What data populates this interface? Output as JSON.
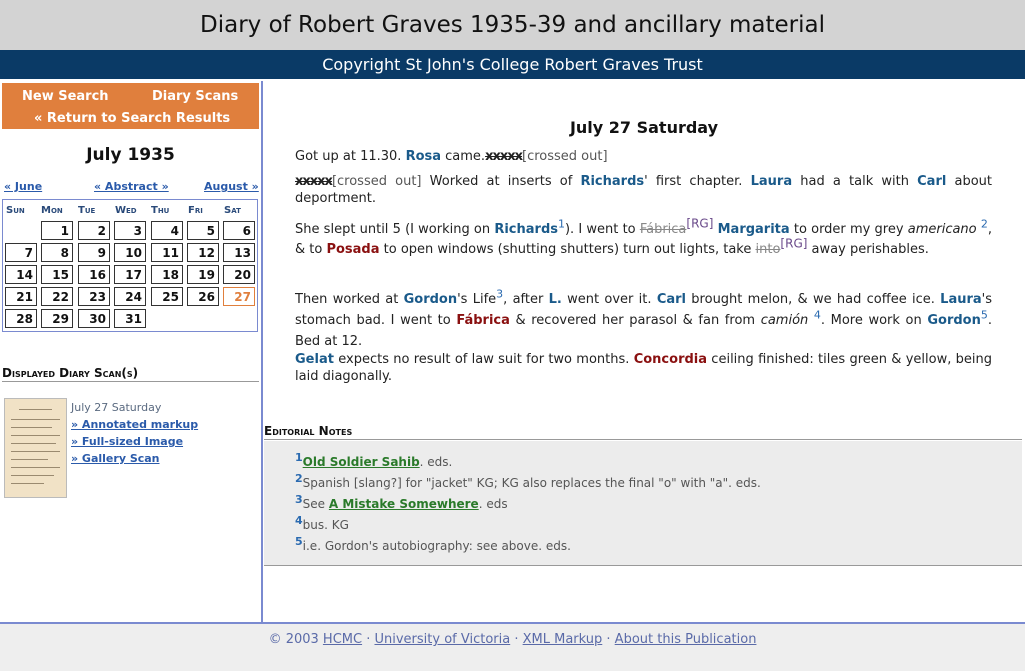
{
  "header": {
    "title": "Diary of Robert Graves 1935-39 and ancillary material",
    "copyright": "Copyright St John's College Robert Graves Trust"
  },
  "nav": {
    "new_search": "New Search",
    "diary_scans": "Diary Scans",
    "return": "« Return to Search Results"
  },
  "calendar": {
    "title": "July 1935",
    "prev": "« June",
    "abstract": "« Abstract »",
    "next": "August »",
    "dow": [
      "Sun",
      "Mon",
      "Tue",
      "Wed",
      "Thu",
      "Fri",
      "Sat"
    ],
    "days": [
      "1",
      "2",
      "3",
      "4",
      "5",
      "6",
      "7",
      "8",
      "9",
      "10",
      "11",
      "12",
      "13",
      "14",
      "15",
      "16",
      "17",
      "18",
      "19",
      "20",
      "21",
      "22",
      "23",
      "24",
      "25",
      "26",
      "27",
      "28",
      "29",
      "30",
      "31"
    ],
    "current_day": "27"
  },
  "scans": {
    "heading": "Displayed Diary Scan(s)",
    "date": "July 27 Saturday",
    "annotated": "» Annotated markup",
    "full": "» Full-sized Image",
    "gallery": "» Gallery Scan"
  },
  "entry": {
    "date": "July 27 Saturday",
    "p1": {
      "a": "Got up at 11.30. ",
      "rosa": "Rosa",
      "b": " came.",
      "x": "xxxxx",
      "c": "[crossed out]"
    },
    "p2": {
      "x": "xxxxx",
      "c": "[crossed out]",
      "a": " Worked at inserts of ",
      "richards": "Richards",
      "b": "' first chapter. ",
      "laura": "Laura",
      "c2": " had a talk with ",
      "carl": "Carl",
      "d": " about deportment."
    },
    "p3": {
      "a": "She slept until 5 (I working on ",
      "richards": "Richards",
      "fn1": "1",
      "b": "). I went to ",
      "fabrica": "Fábrica",
      "rg1": "[RG]",
      "c": " ",
      "margarita": "Margarita",
      "d": " to order my grey ",
      "americano": "americano",
      "fn2": "2",
      "e": ", & to ",
      "posada": "Posada",
      "f": " to open windows (shutting shutters) turn out lights, take ",
      "into": "into",
      "rg2": "[RG]",
      "g": " away perishables."
    },
    "p4": {
      "a": "Then worked at ",
      "gordon": "Gordon",
      "b": "'s Life",
      "fn3": "3",
      "c": ", after ",
      "l": "L.",
      "d": " went over it. ",
      "carl": "Carl",
      "e": " brought melon, & we had coffee ice. ",
      "laura": "Laura",
      "f": "'s stomach bad. I went to ",
      "fabrica": "Fábrica",
      "g": " & recovered her parasol & fan from ",
      "camion": "camión",
      "fn4": "4",
      "h": ". More work on ",
      "gordon2": "Gordon",
      "fn5": "5",
      "i": ". Bed at 12."
    },
    "p5": {
      "gelat": "Gelat",
      "a": " expects no result of law suit for two months. ",
      "concordia": "Concordia",
      "b": " ceiling finished: tiles green & yellow, being laid diagonally."
    }
  },
  "notes": {
    "heading": "Editorial Notes",
    "n1": {
      "num": "1",
      "title": "Old Soldier Sahib",
      "rest": ". eds."
    },
    "n2": {
      "num": "2",
      "text": "Spanish [slang?] for \"jacket\" KG; KG also replaces the final \"o\" with \"a\". eds."
    },
    "n3": {
      "num": "3",
      "pre": "See ",
      "title": "A Mistake Somewhere",
      "rest": ". eds"
    },
    "n4": {
      "num": "4",
      "text": "bus. KG"
    },
    "n5": {
      "num": "5",
      "text": "i.e. Gordon's autobiography: see above. eds."
    }
  },
  "footer": {
    "copy": "© 2003 ",
    "hcmc": "HCMC",
    "sep": " · ",
    "uvic": "University of Victoria",
    "xml": "XML Markup",
    "about": "About this Publication"
  },
  "colors": {
    "accent": "#e07f3d",
    "bar": "#0a3a66",
    "person": "#1a5a8a",
    "place": "#8a1010"
  }
}
